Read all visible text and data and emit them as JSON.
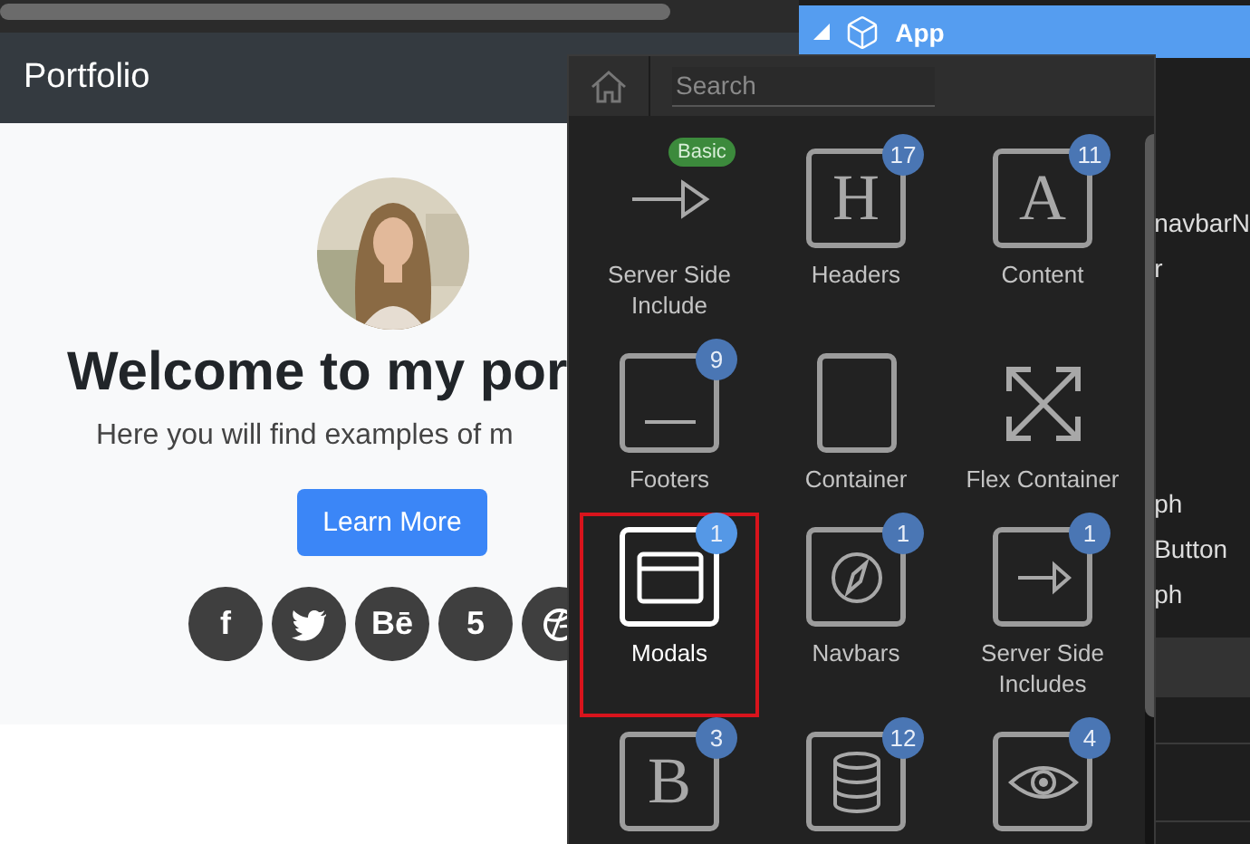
{
  "preview": {
    "brand": "Portfolio",
    "heading": "Welcome to my por",
    "subtitle": "Here you will find examples of m",
    "button": "Learn More",
    "social": [
      {
        "kind": "glyph",
        "glyph": "f"
      },
      {
        "kind": "bird"
      },
      {
        "kind": "glyph",
        "glyph": "Bē"
      },
      {
        "kind": "shield",
        "glyph": "5"
      },
      {
        "kind": "ball"
      }
    ]
  },
  "tree": {
    "root": {
      "label": "App",
      "expanded": true,
      "selected": true
    },
    "fragments": [
      "navbarN",
      "r",
      "ph",
      "Button",
      "ph"
    ]
  },
  "picker": {
    "search": {
      "placeholder": "Search"
    },
    "items": [
      {
        "label": "Server Side Include",
        "kind": "arrow",
        "badge": {
          "kind": "tag",
          "text": "Basic"
        },
        "selected": false
      },
      {
        "label": "Headers",
        "kind": "letter",
        "glyph": "H",
        "badge": {
          "kind": "count",
          "text": "17"
        },
        "selected": false
      },
      {
        "label": "Content",
        "kind": "letter",
        "glyph": "A",
        "badge": {
          "kind": "count",
          "text": "11"
        },
        "selected": false
      },
      {
        "label": "Footers",
        "kind": "footer",
        "badge": {
          "kind": "count",
          "text": "9"
        },
        "selected": false
      },
      {
        "label": "Container",
        "kind": "container",
        "selected": false
      },
      {
        "label": "Flex Container",
        "kind": "expand",
        "selected": false
      },
      {
        "label": "Modals",
        "kind": "window",
        "badge": {
          "kind": "count",
          "text": "1"
        },
        "selected": true
      },
      {
        "label": "Navbars",
        "kind": "compass",
        "badge": {
          "kind": "count",
          "text": "1"
        },
        "selected": false
      },
      {
        "label": "Server Side Includes",
        "kind": "frame-arrow",
        "badge": {
          "kind": "count",
          "text": "1"
        },
        "selected": false
      },
      {
        "kind": "letter",
        "glyph": "B",
        "badge": {
          "kind": "count",
          "text": "3"
        },
        "selected": false
      },
      {
        "kind": "database",
        "badge": {
          "kind": "count",
          "text": "12"
        },
        "selected": false
      },
      {
        "kind": "eye",
        "badge": {
          "kind": "count",
          "text": "4"
        },
        "selected": false
      }
    ]
  }
}
